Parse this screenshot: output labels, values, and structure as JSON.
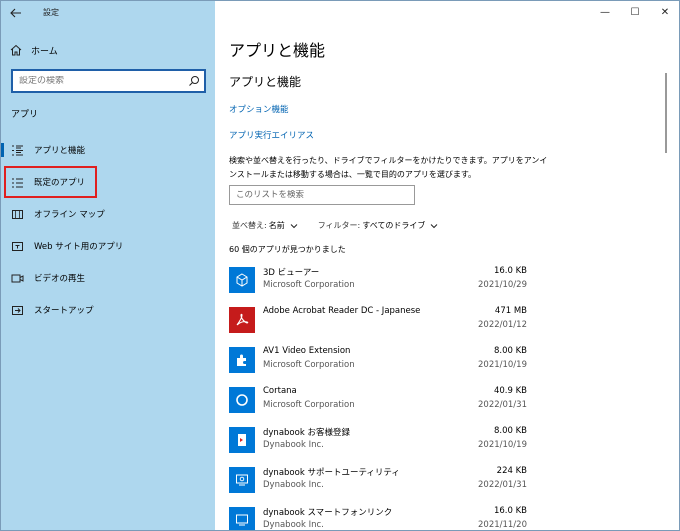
{
  "window": {
    "title": "設定",
    "back_icon": "back-arrow-icon",
    "controls": {
      "minimize": "—",
      "maximize": "☐",
      "close": "✕"
    }
  },
  "sidebar": {
    "home_label": "ホーム",
    "search_placeholder": "設定の検索",
    "section_label": "アプリ",
    "items": [
      {
        "label": "アプリと機能",
        "icon": "apps-features-icon",
        "active": true
      },
      {
        "label": "既定のアプリ",
        "icon": "default-apps-icon",
        "highlighted": true
      },
      {
        "label": "オフライン マップ",
        "icon": "offline-maps-icon"
      },
      {
        "label": "Web サイト用のアプリ",
        "icon": "apps-for-websites-icon"
      },
      {
        "label": "ビデオの再生",
        "icon": "video-playback-icon"
      },
      {
        "label": "スタートアップ",
        "icon": "startup-icon"
      }
    ],
    "colors": {
      "background": "#aed7ee",
      "accent": "#0063b1",
      "highlight": "#e01f1f"
    }
  },
  "main": {
    "page_title": "アプリと機能",
    "section_title": "アプリと機能",
    "links": {
      "optional_features": "オプション機能",
      "app_execution_aliases": "アプリ実行エイリアス"
    },
    "description": "検索や並べ替えを行ったり、ドライブでフィルターをかけたりできます。アプリをアンインストールまたは移動する場合は、一覧で目的のアプリを選びます。",
    "list_search_placeholder": "このリストを検索",
    "sort": {
      "label": "並べ替え:",
      "value": "名前"
    },
    "filter": {
      "label": "フィルター:",
      "value": "すべてのドライブ"
    },
    "count_text": "60 個のアプリが見つかりました",
    "apps": [
      {
        "name": "3D ビューアー",
        "publisher": "Microsoft Corporation",
        "size": "16.0 KB",
        "date": "2021/10/29",
        "icon": "3d-viewer-icon"
      },
      {
        "name": "Adobe Acrobat Reader DC - Japanese",
        "publisher": "",
        "size": "471 MB",
        "date": "2022/01/12",
        "icon": "acrobat-icon"
      },
      {
        "name": "AV1 Video Extension",
        "publisher": "Microsoft Corporation",
        "size": "8.00 KB",
        "date": "2021/10/19",
        "icon": "puzzle-extension-icon"
      },
      {
        "name": "Cortana",
        "publisher": "Microsoft Corporation",
        "size": "40.9 KB",
        "date": "2022/01/31",
        "icon": "cortana-icon"
      },
      {
        "name": "dynabook お客様登録",
        "publisher": "Dynabook Inc.",
        "size": "8.00 KB",
        "date": "2021/10/19",
        "icon": "registration-icon"
      },
      {
        "name": "dynabook サポートユーティリティ",
        "publisher": "Dynabook Inc.",
        "size": "224 KB",
        "date": "2022/01/31",
        "icon": "support-utility-icon"
      },
      {
        "name": "dynabook スマートフォンリンク",
        "publisher": "Dynabook Inc.",
        "size": "16.0 KB",
        "date": "2021/11/20",
        "icon": "smartphone-link-icon"
      }
    ]
  }
}
